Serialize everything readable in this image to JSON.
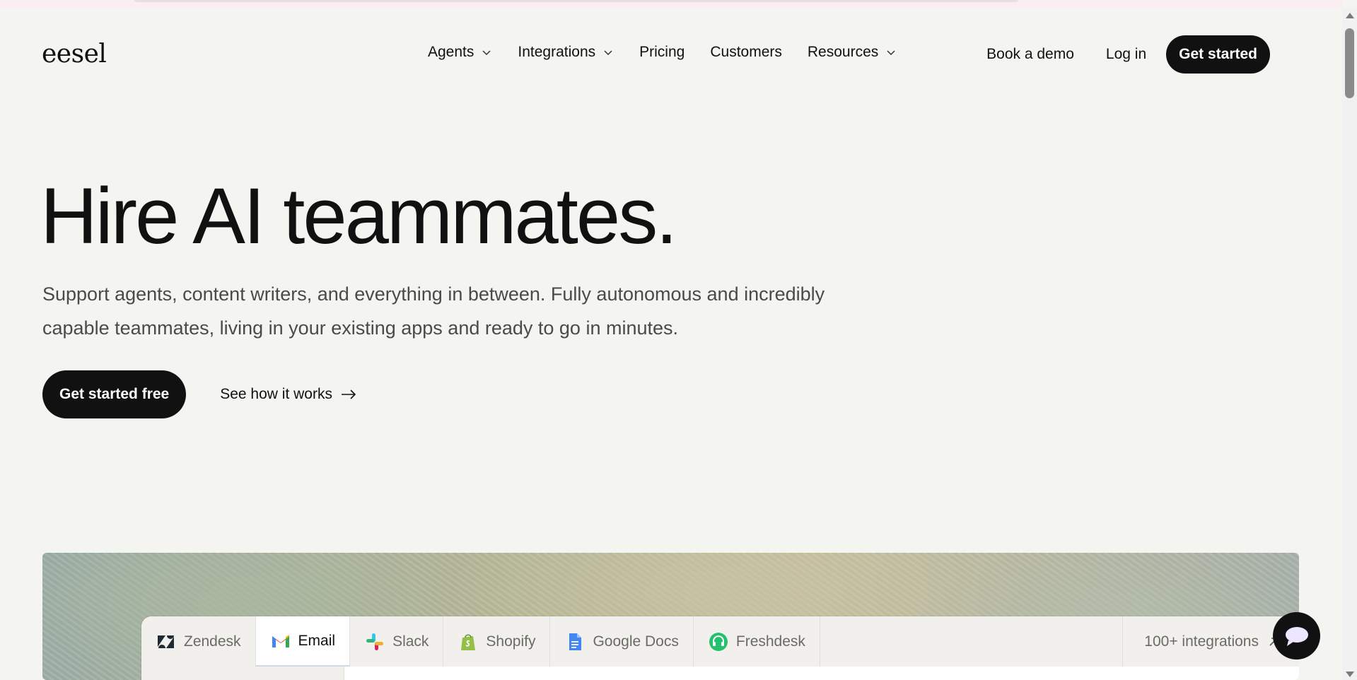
{
  "header": {
    "logo": "eesel",
    "nav": [
      {
        "label": "Agents",
        "dropdown": true
      },
      {
        "label": "Integrations",
        "dropdown": true
      },
      {
        "label": "Pricing",
        "dropdown": false
      },
      {
        "label": "Customers",
        "dropdown": false
      },
      {
        "label": "Resources",
        "dropdown": true
      }
    ],
    "book_demo": "Book a demo",
    "login": "Log in",
    "get_started": "Get started"
  },
  "hero": {
    "title": "Hire AI teammates.",
    "subtitle": "Support agents, content writers, and everything in between. Fully autonomous and incredibly capable teammates, living in your existing apps and ready to go in minutes.",
    "cta_primary": "Get started free",
    "cta_secondary": "See how it works"
  },
  "showcase": {
    "tabs": [
      {
        "label": "Zendesk",
        "icon": "zendesk-icon",
        "active": false
      },
      {
        "label": "Email",
        "icon": "gmail-icon",
        "active": true
      },
      {
        "label": "Slack",
        "icon": "slack-icon",
        "active": false
      },
      {
        "label": "Shopify",
        "icon": "shopify-icon",
        "active": false
      },
      {
        "label": "Google Docs",
        "icon": "google-docs-icon",
        "active": false
      },
      {
        "label": "Freshdesk",
        "icon": "freshdesk-icon",
        "active": false
      }
    ],
    "more": "100+ integrations"
  },
  "colors": {
    "background": "#f4f4f0",
    "primary": "#111111",
    "muted_text": "#4a4a46"
  }
}
